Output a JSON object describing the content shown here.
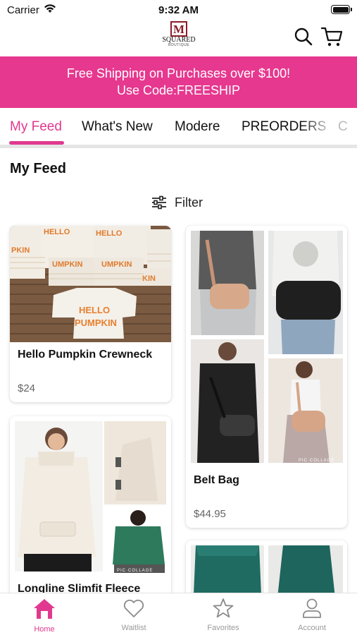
{
  "status_bar": {
    "carrier": "Carrier",
    "time": "9:32 AM"
  },
  "brand": {
    "logo_letter": "M",
    "logo_text": "SQUARED",
    "logo_sub": "BOUTIQUE"
  },
  "promo": {
    "line1": "Free Shipping on Purchases over $100!",
    "line2": "Use Code:FREESHIP",
    "color": "#e6388f"
  },
  "tabs": [
    {
      "label": "My Feed",
      "active": true
    },
    {
      "label": "What's New"
    },
    {
      "label": "Modere"
    },
    {
      "label": "PREORDERS"
    },
    {
      "label": "C"
    }
  ],
  "section_title": "My Feed",
  "filter_label": "Filter",
  "products": [
    {
      "name": "Hello Pumpkin Crewneck",
      "price": "$24"
    },
    {
      "name": "Belt Bag",
      "price": "$44.95"
    },
    {
      "name": "Longline Slimfit Fleece",
      "price": ""
    },
    {
      "name": "",
      "price": ""
    }
  ],
  "image_text": {
    "pumpkin": "HELLO PUMPKIN",
    "collage": "PIC·COLLAGE"
  },
  "bottom_nav": [
    {
      "label": "Home",
      "icon": "home-icon",
      "active": true
    },
    {
      "label": "Waitlist",
      "icon": "heart-icon"
    },
    {
      "label": "Favorites",
      "icon": "star-icon"
    },
    {
      "label": "Account",
      "icon": "person-icon"
    }
  ],
  "accent_color": "#e0398f"
}
